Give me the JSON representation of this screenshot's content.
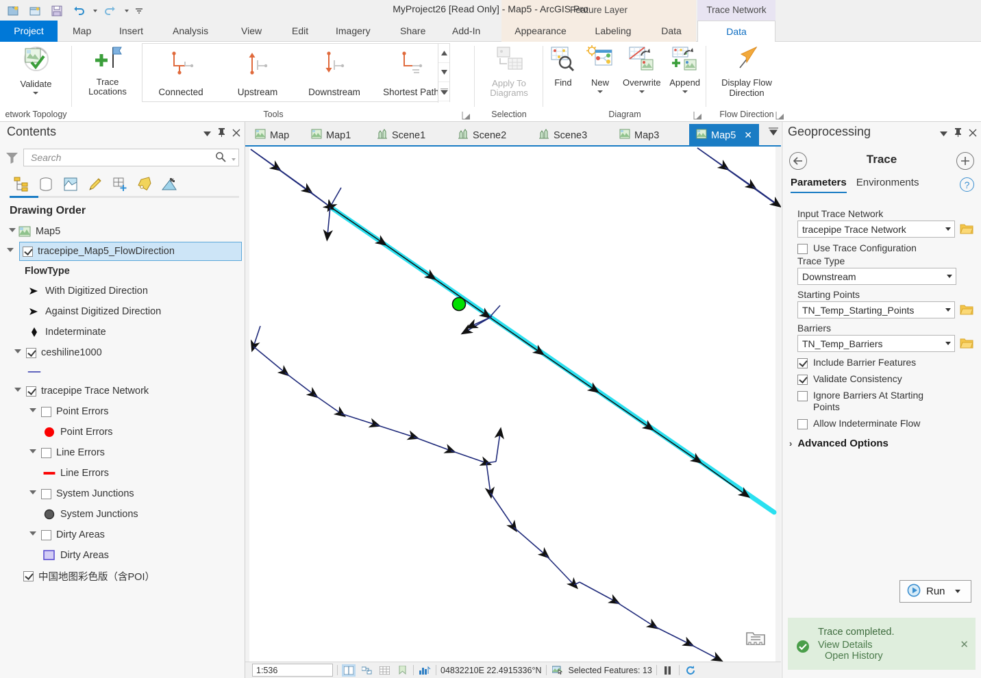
{
  "window": {
    "title": "MyProject26 [Read Only] - Map5 - ArcGIS Pro",
    "quick_access": [
      "new-project-icon",
      "open-project-icon",
      "save-project-icon",
      "undo-icon",
      "redo-icon",
      "customize-qat-icon"
    ]
  },
  "contextual_groups": [
    {
      "label": "Feature Layer",
      "tabs": [
        "Appearance",
        "Labeling",
        "Data"
      ]
    },
    {
      "label": "Trace Network",
      "tabs": [
        "Data"
      ]
    }
  ],
  "ribbon": {
    "tabs": [
      "Project",
      "Map",
      "Insert",
      "Analysis",
      "View",
      "Edit",
      "Imagery",
      "Share",
      "Add-In"
    ],
    "active_tab": "Data",
    "contextual_feature_tabs": [
      "Appearance",
      "Labeling",
      "Data"
    ],
    "contextual_trace_tabs": [
      "Data"
    ],
    "groups": [
      {
        "name": "network-topology",
        "title": "etwork Topology",
        "buttons": [
          {
            "label": "Validate",
            "icon": "validate-topology-icon",
            "has_menu": true
          }
        ]
      },
      {
        "name": "tools",
        "title": "Tools",
        "buttons": [
          {
            "label": "Trace Locations",
            "icon": "trace-locations-icon",
            "has_menu": true
          }
        ],
        "gallery": [
          {
            "label": "Connected",
            "icon": "connected-trace-icon"
          },
          {
            "label": "Upstream",
            "icon": "upstream-trace-icon"
          },
          {
            "label": "Downstream",
            "icon": "downstream-trace-icon"
          },
          {
            "label": "Shortest Path",
            "icon": "shortest-path-icon"
          }
        ]
      },
      {
        "name": "selection",
        "title": "Selection",
        "buttons": [
          {
            "label": "Apply To Diagrams",
            "icon": "apply-to-diagrams-icon",
            "has_menu": true,
            "disabled": true
          }
        ]
      },
      {
        "name": "diagram",
        "title": "Diagram",
        "buttons": [
          {
            "label": "Find",
            "icon": "find-diagram-icon",
            "has_menu": false
          },
          {
            "label": "New",
            "icon": "new-diagram-icon",
            "has_menu": true
          },
          {
            "label": "Overwrite",
            "icon": "overwrite-diagram-icon",
            "has_menu": true
          },
          {
            "label": "Append",
            "icon": "append-diagram-icon",
            "has_menu": true
          }
        ]
      },
      {
        "name": "flow-direction",
        "title": "Flow Direction",
        "buttons": [
          {
            "label": "Display Flow Direction",
            "icon": "display-flow-direction-icon",
            "has_menu": false
          }
        ]
      }
    ]
  },
  "contents": {
    "title": "Contents",
    "search": {
      "placeholder": "Search",
      "value": ""
    },
    "toolbar_icons": [
      "list-by-drawing-order-icon",
      "list-by-data-source-icon",
      "list-by-selection-icon",
      "list-by-editing-icon",
      "list-by-snapping-icon",
      "list-by-labeling-icon",
      "list-by-charts-icon"
    ],
    "heading": "Drawing Order",
    "tree": [
      {
        "label": "Map5",
        "level": 0,
        "type": "map",
        "expander": "open",
        "icon": "map-icon"
      },
      {
        "label": "tracepipe_Map5_FlowDirection",
        "level": 1,
        "type": "layer",
        "expander": "open",
        "checked": true,
        "selected": true
      },
      {
        "label": "FlowType",
        "level": 2,
        "type": "renderer-heading"
      },
      {
        "label": "With Digitized Direction",
        "level": 3,
        "type": "symbol",
        "symbol": "arrow-right-symbol"
      },
      {
        "label": "Against Digitized Direction",
        "level": 3,
        "type": "symbol",
        "symbol": "arrow-right-symbol"
      },
      {
        "label": "Indeterminate",
        "level": 3,
        "type": "symbol",
        "symbol": "diamond-symbol"
      },
      {
        "label": "ceshiline1000",
        "level": 1,
        "type": "layer",
        "expander": "open",
        "checked": true
      },
      {
        "label": "",
        "level": 3,
        "type": "symbol",
        "symbol": "line-symbol-blue"
      },
      {
        "label": "tracepipe Trace Network",
        "level": 1,
        "type": "layer",
        "expander": "open",
        "checked": true
      },
      {
        "label": "Point Errors",
        "level": 2,
        "type": "sublayer",
        "expander": "open",
        "checked": false
      },
      {
        "label": "Point Errors",
        "level": 3,
        "type": "symbol",
        "symbol": "red-circle-symbol"
      },
      {
        "label": "Line Errors",
        "level": 2,
        "type": "sublayer",
        "expander": "open",
        "checked": false
      },
      {
        "label": "Line Errors",
        "level": 3,
        "type": "symbol",
        "symbol": "red-line-symbol"
      },
      {
        "label": "System Junctions",
        "level": 2,
        "type": "sublayer",
        "expander": "open",
        "checked": false
      },
      {
        "label": "System Junctions",
        "level": 3,
        "type": "symbol",
        "symbol": "gray-circle-symbol"
      },
      {
        "label": "Dirty Areas",
        "level": 2,
        "type": "sublayer",
        "expander": "open",
        "checked": false
      },
      {
        "label": "Dirty Areas",
        "level": 3,
        "type": "symbol",
        "symbol": "purple-square-symbol"
      },
      {
        "label": "中国地图彩色版（含POI）",
        "level": 1,
        "type": "basemap",
        "checked": true
      }
    ]
  },
  "view_tabs": {
    "items": [
      {
        "label": "Map",
        "icon": "map-view-icon",
        "active": false
      },
      {
        "label": "Map1",
        "icon": "map-view-icon",
        "active": false
      },
      {
        "label": "Scene1",
        "icon": "scene-view-icon",
        "active": false
      },
      {
        "label": "Scene2",
        "icon": "scene-view-icon",
        "active": false
      },
      {
        "label": "Scene3",
        "icon": "scene-view-icon",
        "active": false
      },
      {
        "label": "Map3",
        "icon": "map-view-icon",
        "active": false
      },
      {
        "label": "Map5",
        "icon": "map-view-icon",
        "active": true
      }
    ],
    "close_label": "✕",
    "more_icon": "tab-list-icon"
  },
  "map": {
    "overview_icon": "basemap-overview-icon",
    "trace_result_color": "#2ae0f0",
    "starting_point_color": "#00e000",
    "network_line_color": "#1f2a7a"
  },
  "status_bar": {
    "scale": "1:536",
    "coordinates": "04832210E 22.4915336°N",
    "selected_text": "Selected Features: 13",
    "buttons": [
      "dual-view-icon",
      "link-views-icon",
      "grid-icon",
      "bookmark-icon",
      "chart-icon",
      "selection-icon",
      "pause-icon",
      "refresh-icon"
    ]
  },
  "geoprocessing": {
    "title": "Geoprocessing",
    "back_icon": "back-arrow-icon",
    "add_icon": "add-tool-icon",
    "tool_name": "Trace",
    "tabs": [
      {
        "label": "Parameters",
        "active": true
      },
      {
        "label": "Environments",
        "active": false
      }
    ],
    "help_icon": "help-icon",
    "fields": [
      {
        "label": "Input Trace Network",
        "value": "tracepipe Trace Network",
        "browse": true
      },
      {
        "label": "Trace Type",
        "value": "Downstream",
        "browse": false
      },
      {
        "label": "Starting Points",
        "value": "TN_Temp_Starting_Points",
        "browse": true
      },
      {
        "label": "Barriers",
        "value": "TN_Temp_Barriers",
        "browse": true
      }
    ],
    "checkboxes": [
      {
        "label": "Use Trace Configuration",
        "checked": false
      },
      {
        "label": "Include Barrier Features",
        "checked": true
      },
      {
        "label": "Validate Consistency",
        "checked": true
      },
      {
        "label": "Ignore Barriers At Starting Points",
        "checked": false
      },
      {
        "label": "Allow Indeterminate Flow",
        "checked": false
      }
    ],
    "advanced_options": "Advanced Options",
    "run_button": {
      "label": "Run",
      "icon": "run-icon"
    },
    "toast": {
      "message": "Trace completed.",
      "links": [
        "View Details",
        "Open History"
      ],
      "status_icon": "success-check-icon",
      "close_label": "✕",
      "background": "#dfeedd"
    }
  }
}
